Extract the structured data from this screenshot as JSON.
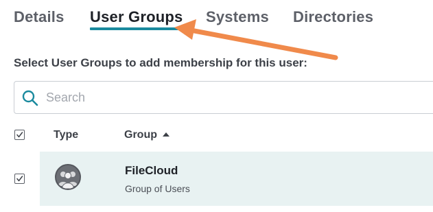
{
  "tabs": [
    {
      "label": "Details",
      "active": false
    },
    {
      "label": "User Groups",
      "active": true
    },
    {
      "label": "Systems",
      "active": false
    },
    {
      "label": "Directories",
      "active": false
    }
  ],
  "instruction": "Select User Groups to add membership for this user:",
  "search": {
    "placeholder": "Search",
    "value": "",
    "icon": "search-icon"
  },
  "table": {
    "select_all_checked": true,
    "columns": [
      {
        "label": "Type"
      },
      {
        "label": "Group",
        "sort": "ascending"
      }
    ],
    "rows": [
      {
        "checked": true,
        "type_icon": "user-group-icon",
        "name": "FileCloud",
        "description": "Group of Users"
      }
    ]
  },
  "colors": {
    "accent": "#1a8a9e",
    "row_highlight": "#e8f2f2",
    "annotation_arrow": "#f08a4b"
  }
}
